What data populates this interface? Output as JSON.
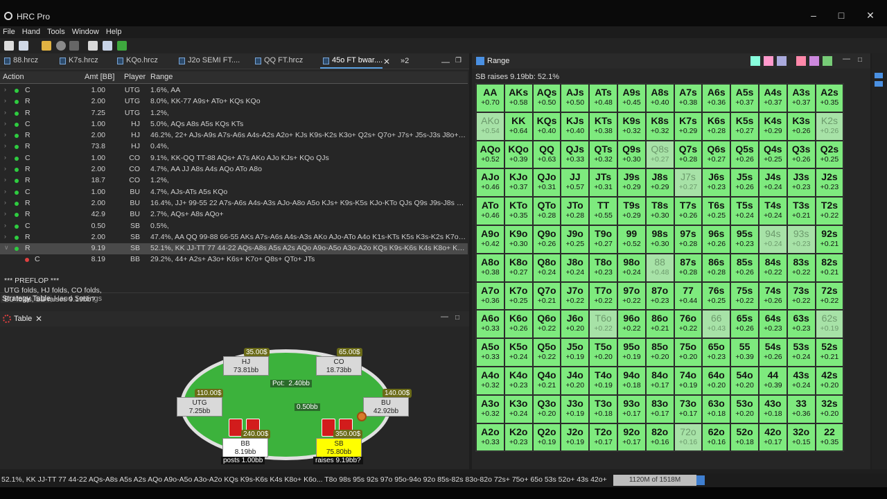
{
  "app": {
    "title": "HRC Pro"
  },
  "menu": [
    "File",
    "Hand",
    "Tools",
    "Window",
    "Help"
  ],
  "tabs": [
    {
      "label": "88.hrcz",
      "active": false
    },
    {
      "label": "K7s.hrcz",
      "active": false
    },
    {
      "label": "KQo.hrcz",
      "active": false
    },
    {
      "label": "J2o SEMI FT....",
      "active": false
    },
    {
      "label": "QQ FT.hrcz",
      "active": false
    },
    {
      "label": "45o FT bwar....",
      "active": true
    }
  ],
  "tabs_overflow": "»2",
  "grid": {
    "headers": {
      "action": "Action",
      "amt": "Amt [BB]",
      "player": "Player",
      "range": "Range"
    },
    "rows": [
      {
        "action": "C",
        "amt": "1.00",
        "player": "UTG",
        "range": "1.6%, AA"
      },
      {
        "action": "R",
        "amt": "2.00",
        "player": "UTG",
        "range": "8.0%, KK-77 A9s+ ATo+ KQs KQo"
      },
      {
        "action": "R",
        "amt": "7.25",
        "player": "UTG",
        "range": "1.2%,"
      },
      {
        "action": "C",
        "amt": "1.00",
        "player": "HJ",
        "range": "5.0%, AQs A8s A5s KQs KTs"
      },
      {
        "action": "R",
        "amt": "2.00",
        "player": "HJ",
        "range": "46.2%, 22+ AJs-A9s A7s-A6s A4s-A2s A2o+ KJs K9s-K2s K3o+ Q2s+ Q7o+ J7s+ J5s-J3s J8o+ T7..."
      },
      {
        "action": "R",
        "amt": "73.8",
        "player": "HJ",
        "range": "0.4%,"
      },
      {
        "action": "C",
        "amt": "1.00",
        "player": "CO",
        "range": "9.1%, KK-QQ TT-88 AQs+ A7s AKo AJo KJs+ KQo QJs"
      },
      {
        "action": "R",
        "amt": "2.00",
        "player": "CO",
        "range": "4.7%, AA JJ A8s A4s AQo ATo A8o"
      },
      {
        "action": "R",
        "amt": "18.7",
        "player": "CO",
        "range": "1.2%,"
      },
      {
        "action": "C",
        "amt": "1.00",
        "player": "BU",
        "range": "4.7%, AJs-ATs A5s KQo"
      },
      {
        "action": "R",
        "amt": "2.00",
        "player": "BU",
        "range": "16.4%, JJ+ 99-55 22 A7s-A6s A4s-A3s AJo-A8o A5o KJs+ K9s-K5s KJo-KTo QJs Q9s J9s-J8s 87s"
      },
      {
        "action": "R",
        "amt": "42.9",
        "player": "BU",
        "range": "2.7%, AQs+ A8s AQo+"
      },
      {
        "action": "C",
        "amt": "0.50",
        "player": "SB",
        "range": "0.5%,"
      },
      {
        "action": "R",
        "amt": "2.00",
        "player": "SB",
        "range": "47.4%, AA QQ 99-88 66-55 AKs A7s-A6s A4s-A3s AKo AJo-ATo A4o K1s-KTs K5s K3s-K2s K7o K..."
      },
      {
        "action": "R",
        "amt": "9.19",
        "player": "SB",
        "range": "52.1%, KK JJ-TT 77 44-22 AQs-A8s A5s A2s AQo A9o-A5o A3o-A2o KQs K9s-K6s K4s K8o+ K6o-..."
      },
      {
        "action": "C",
        "amt": "8.19",
        "player": "BB",
        "range": "29.2%, 44+ A2s+ A3o+ K6s+ K7o+ Q8s+ QTo+ JTs"
      }
    ]
  },
  "subtabs": [
    "Strategy Table",
    "Hand Settings"
  ],
  "table_panel": {
    "title": "Table",
    "log": [
      "*** PREFLOP ***",
      "UTG folds, HJ folds, CO folds,",
      "BU folds, SB raises 9.19bb?"
    ],
    "pot": "Pot:",
    "pot_value": "2.40bb",
    "center_bet": "0.50bb",
    "seats": {
      "hj": {
        "name": "HJ",
        "stack": "73.81bb",
        "money": "35.00$"
      },
      "co": {
        "name": "CO",
        "stack": "18.73bb",
        "money": "65.00$"
      },
      "utg": {
        "name": "UTG",
        "stack": "7.25bb",
        "money": "110.00$"
      },
      "bu": {
        "name": "BU",
        "stack": "42.92bb",
        "money": "140.00$"
      },
      "bb": {
        "name": "BB",
        "stack": "8.19bb",
        "money": "240.00$",
        "caption": "posts 1.00bb"
      },
      "sb": {
        "name": "SB",
        "stack": "75.80bb",
        "money": "350.00$",
        "caption": "raises 9.19bb?"
      }
    }
  },
  "range_panel": {
    "title": "Range",
    "subtitle": "SB raises 9.19bb: 52.1%",
    "cells": [
      [
        "AA",
        "+0.70",
        1
      ],
      [
        "AKs",
        "+0.58",
        1
      ],
      [
        "AQs",
        "+0.50",
        1
      ],
      [
        "AJs",
        "+0.50",
        1
      ],
      [
        "ATs",
        "+0.48",
        1
      ],
      [
        "A9s",
        "+0.45",
        1
      ],
      [
        "A8s",
        "+0.40",
        1
      ],
      [
        "A7s",
        "+0.38",
        1
      ],
      [
        "A6s",
        "+0.36",
        1
      ],
      [
        "A5s",
        "+0.37",
        1
      ],
      [
        "A4s",
        "+0.37",
        1
      ],
      [
        "A3s",
        "+0.37",
        1
      ],
      [
        "A2s",
        "+0.35",
        1
      ],
      [
        "AKo",
        "+0.54",
        0
      ],
      [
        "KK",
        "+0.64",
        1
      ],
      [
        "KQs",
        "+0.40",
        1
      ],
      [
        "KJs",
        "+0.40",
        1
      ],
      [
        "KTs",
        "+0.38",
        1
      ],
      [
        "K9s",
        "+0.32",
        1
      ],
      [
        "K8s",
        "+0.32",
        1
      ],
      [
        "K7s",
        "+0.29",
        1
      ],
      [
        "K6s",
        "+0.28",
        1
      ],
      [
        "K5s",
        "+0.27",
        1
      ],
      [
        "K4s",
        "+0.29",
        1
      ],
      [
        "K3s",
        "+0.26",
        1
      ],
      [
        "K2s",
        "+0.26",
        0
      ],
      [
        "AQo",
        "+0.52",
        1
      ],
      [
        "KQo",
        "+0.39",
        1
      ],
      [
        "QQ",
        "+0.63",
        1
      ],
      [
        "QJs",
        "+0.33",
        1
      ],
      [
        "QTs",
        "+0.32",
        1
      ],
      [
        "Q9s",
        "+0.30",
        1
      ],
      [
        "Q8s",
        "+0.27",
        0
      ],
      [
        "Q7s",
        "+0.28",
        1
      ],
      [
        "Q6s",
        "+0.27",
        1
      ],
      [
        "Q5s",
        "+0.26",
        1
      ],
      [
        "Q4s",
        "+0.25",
        1
      ],
      [
        "Q3s",
        "+0.26",
        1
      ],
      [
        "Q2s",
        "+0.25",
        1
      ],
      [
        "AJo",
        "+0.46",
        1
      ],
      [
        "KJo",
        "+0.37",
        1
      ],
      [
        "QJo",
        "+0.31",
        1
      ],
      [
        "JJ",
        "+0.57",
        1
      ],
      [
        "JTs",
        "+0.31",
        1
      ],
      [
        "J9s",
        "+0.29",
        1
      ],
      [
        "J8s",
        "+0.29",
        1
      ],
      [
        "J7s",
        "+0.27",
        0
      ],
      [
        "J6s",
        "+0.23",
        1
      ],
      [
        "J5s",
        "+0.26",
        1
      ],
      [
        "J4s",
        "+0.24",
        1
      ],
      [
        "J3s",
        "+0.23",
        1
      ],
      [
        "J2s",
        "+0.23",
        1
      ],
      [
        "ATo",
        "+0.46",
        1
      ],
      [
        "KTo",
        "+0.35",
        1
      ],
      [
        "QTo",
        "+0.28",
        1
      ],
      [
        "JTo",
        "+0.28",
        1
      ],
      [
        "TT",
        "+0.55",
        1
      ],
      [
        "T9s",
        "+0.29",
        1
      ],
      [
        "T8s",
        "+0.30",
        1
      ],
      [
        "T7s",
        "+0.26",
        1
      ],
      [
        "T6s",
        "+0.25",
        1
      ],
      [
        "T5s",
        "+0.24",
        1
      ],
      [
        "T4s",
        "+0.24",
        1
      ],
      [
        "T3s",
        "+0.21",
        1
      ],
      [
        "T2s",
        "+0.22",
        1
      ],
      [
        "A9o",
        "+0.42",
        1
      ],
      [
        "K9o",
        "+0.30",
        1
      ],
      [
        "Q9o",
        "+0.26",
        1
      ],
      [
        "J9o",
        "+0.25",
        1
      ],
      [
        "T9o",
        "+0.27",
        1
      ],
      [
        "99",
        "+0.52",
        1
      ],
      [
        "98s",
        "+0.30",
        1
      ],
      [
        "97s",
        "+0.28",
        1
      ],
      [
        "96s",
        "+0.26",
        1
      ],
      [
        "95s",
        "+0.23",
        1
      ],
      [
        "94s",
        "+0.24",
        0
      ],
      [
        "93s",
        "+0.23",
        0
      ],
      [
        "92s",
        "+0.21",
        1
      ],
      [
        "A8o",
        "+0.38",
        1
      ],
      [
        "K8o",
        "+0.27",
        1
      ],
      [
        "Q8o",
        "+0.24",
        1
      ],
      [
        "J8o",
        "+0.24",
        1
      ],
      [
        "T8o",
        "+0.23",
        1
      ],
      [
        "98o",
        "+0.24",
        1
      ],
      [
        "88",
        "+0.48",
        0
      ],
      [
        "87s",
        "+0.28",
        1
      ],
      [
        "86s",
        "+0.28",
        1
      ],
      [
        "85s",
        "+0.26",
        1
      ],
      [
        "84s",
        "+0.22",
        1
      ],
      [
        "83s",
        "+0.22",
        1
      ],
      [
        "82s",
        "+0.21",
        1
      ],
      [
        "A7o",
        "+0.36",
        1
      ],
      [
        "K7o",
        "+0.25",
        1
      ],
      [
        "Q7o",
        "+0.21",
        1
      ],
      [
        "J7o",
        "+0.22",
        1
      ],
      [
        "T7o",
        "+0.22",
        1
      ],
      [
        "97o",
        "+0.22",
        1
      ],
      [
        "87o",
        "+0.23",
        1
      ],
      [
        "77",
        "+0.44",
        1
      ],
      [
        "76s",
        "+0.25",
        1
      ],
      [
        "75s",
        "+0.22",
        1
      ],
      [
        "74s",
        "+0.26",
        1
      ],
      [
        "73s",
        "+0.22",
        1
      ],
      [
        "72s",
        "+0.22",
        1
      ],
      [
        "A6o",
        "+0.33",
        1
      ],
      [
        "K6o",
        "+0.26",
        1
      ],
      [
        "Q6o",
        "+0.22",
        1
      ],
      [
        "J6o",
        "+0.20",
        1
      ],
      [
        "T6o",
        "+0.22",
        0
      ],
      [
        "96o",
        "+0.22",
        1
      ],
      [
        "86o",
        "+0.21",
        1
      ],
      [
        "76o",
        "+0.22",
        1
      ],
      [
        "66",
        "+0.43",
        0
      ],
      [
        "65s",
        "+0.26",
        1
      ],
      [
        "64s",
        "+0.23",
        1
      ],
      [
        "63s",
        "+0.23",
        1
      ],
      [
        "62s",
        "+0.19",
        0
      ],
      [
        "A5o",
        "+0.33",
        1
      ],
      [
        "K5o",
        "+0.24",
        1
      ],
      [
        "Q5o",
        "+0.22",
        1
      ],
      [
        "J5o",
        "+0.19",
        1
      ],
      [
        "T5o",
        "+0.20",
        1
      ],
      [
        "95o",
        "+0.19",
        1
      ],
      [
        "85o",
        "+0.20",
        1
      ],
      [
        "75o",
        "+0.20",
        1
      ],
      [
        "65o",
        "+0.23",
        1
      ],
      [
        "55",
        "+0.39",
        1
      ],
      [
        "54s",
        "+0.26",
        1
      ],
      [
        "53s",
        "+0.24",
        1
      ],
      [
        "52s",
        "+0.21",
        1
      ],
      [
        "A4o",
        "+0.32",
        1
      ],
      [
        "K4o",
        "+0.23",
        1
      ],
      [
        "Q4o",
        "+0.21",
        1
      ],
      [
        "J4o",
        "+0.20",
        1
      ],
      [
        "T4o",
        "+0.19",
        1
      ],
      [
        "94o",
        "+0.18",
        1
      ],
      [
        "84o",
        "+0.17",
        1
      ],
      [
        "74o",
        "+0.19",
        1
      ],
      [
        "64o",
        "+0.20",
        1
      ],
      [
        "54o",
        "+0.20",
        1
      ],
      [
        "44",
        "+0.39",
        1
      ],
      [
        "43s",
        "+0.24",
        1
      ],
      [
        "42s",
        "+0.20",
        1
      ],
      [
        "A3o",
        "+0.32",
        1
      ],
      [
        "K3o",
        "+0.24",
        1
      ],
      [
        "Q3o",
        "+0.20",
        1
      ],
      [
        "J3o",
        "+0.19",
        1
      ],
      [
        "T3o",
        "+0.18",
        1
      ],
      [
        "93o",
        "+0.17",
        1
      ],
      [
        "83o",
        "+0.17",
        1
      ],
      [
        "73o",
        "+0.17",
        1
      ],
      [
        "63o",
        "+0.18",
        1
      ],
      [
        "53o",
        "+0.20",
        1
      ],
      [
        "43o",
        "+0.18",
        1
      ],
      [
        "33",
        "+0.36",
        1
      ],
      [
        "32s",
        "+0.20",
        1
      ],
      [
        "A2o",
        "+0.33",
        1
      ],
      [
        "K2o",
        "+0.23",
        1
      ],
      [
        "Q2o",
        "+0.19",
        1
      ],
      [
        "J2o",
        "+0.19",
        1
      ],
      [
        "T2o",
        "+0.17",
        1
      ],
      [
        "92o",
        "+0.17",
        1
      ],
      [
        "82o",
        "+0.16",
        1
      ],
      [
        "72o",
        "+0.16",
        0
      ],
      [
        "62o",
        "+0.16",
        1
      ],
      [
        "52o",
        "+0.18",
        1
      ],
      [
        "42o",
        "+0.17",
        1
      ],
      [
        "32o",
        "+0.15",
        1
      ],
      [
        "22",
        "+0.35",
        1
      ]
    ]
  },
  "status": {
    "range_text": "52.1%, KK JJ-TT 77 44-22 AQs-A8s A5s A2s AQo A9o-A5o A3o-A2o KQs K9s-K6s K4s K8o+ K6o... T8o 98s 95s 92s 97o 95o-94o 92o 85s-82s 83o-82o 72s+ 75o+ 65o 53s 52o+ 43s 42o+ 32s",
    "memory": "1120M of 1518M"
  },
  "colors": {
    "in_range": "#7eea7e",
    "partial": "#a7e2a7",
    "felt": "#3cb23c",
    "stack_chip": "#6b6b18",
    "accent": "#5aa0e0"
  }
}
